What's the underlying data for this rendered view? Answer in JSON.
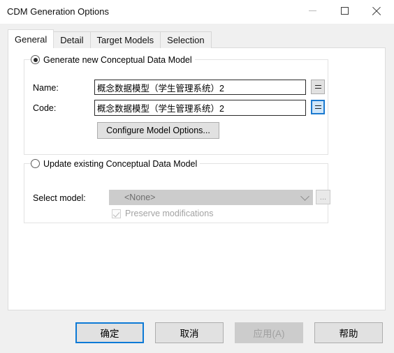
{
  "window": {
    "title": "CDM Generation Options",
    "controls": {
      "minimize": "minimize-icon",
      "maximize": "maximize-icon",
      "close": "close-icon"
    }
  },
  "tabs": [
    {
      "label": "General",
      "active": true
    },
    {
      "label": "Detail",
      "active": false
    },
    {
      "label": "Target Models",
      "active": false
    },
    {
      "label": "Selection",
      "active": false
    }
  ],
  "generate_group": {
    "radio_label": "Generate new Conceptual Data Model",
    "radio_selected": true,
    "name": {
      "label": "Name:",
      "value": "概念数据模型（学生管理系统）2",
      "equals_button": "=",
      "equals_focused": false
    },
    "code": {
      "label": "Code:",
      "value": "概念数据模型（学生管理系统）2",
      "equals_button": "=",
      "equals_focused": true
    },
    "configure_button": "Configure Model Options..."
  },
  "update_group": {
    "radio_label": "Update existing Conceptual Data Model",
    "radio_selected": false,
    "select_model": {
      "label": "Select model:",
      "value": "<None>",
      "browse_button": "..."
    },
    "preserve": {
      "label": "Preserve modifications",
      "checked": true,
      "enabled": false
    }
  },
  "footer": {
    "ok": "确定",
    "cancel": "取消",
    "apply": "应用(A)",
    "help": "帮助"
  },
  "colors": {
    "accent": "#0d7ad6",
    "dialog_bg": "#f0f0f0",
    "panel_bg": "#ffffff",
    "button_face": "#e1e1e1",
    "disabled_text": "#a0a0a0"
  }
}
